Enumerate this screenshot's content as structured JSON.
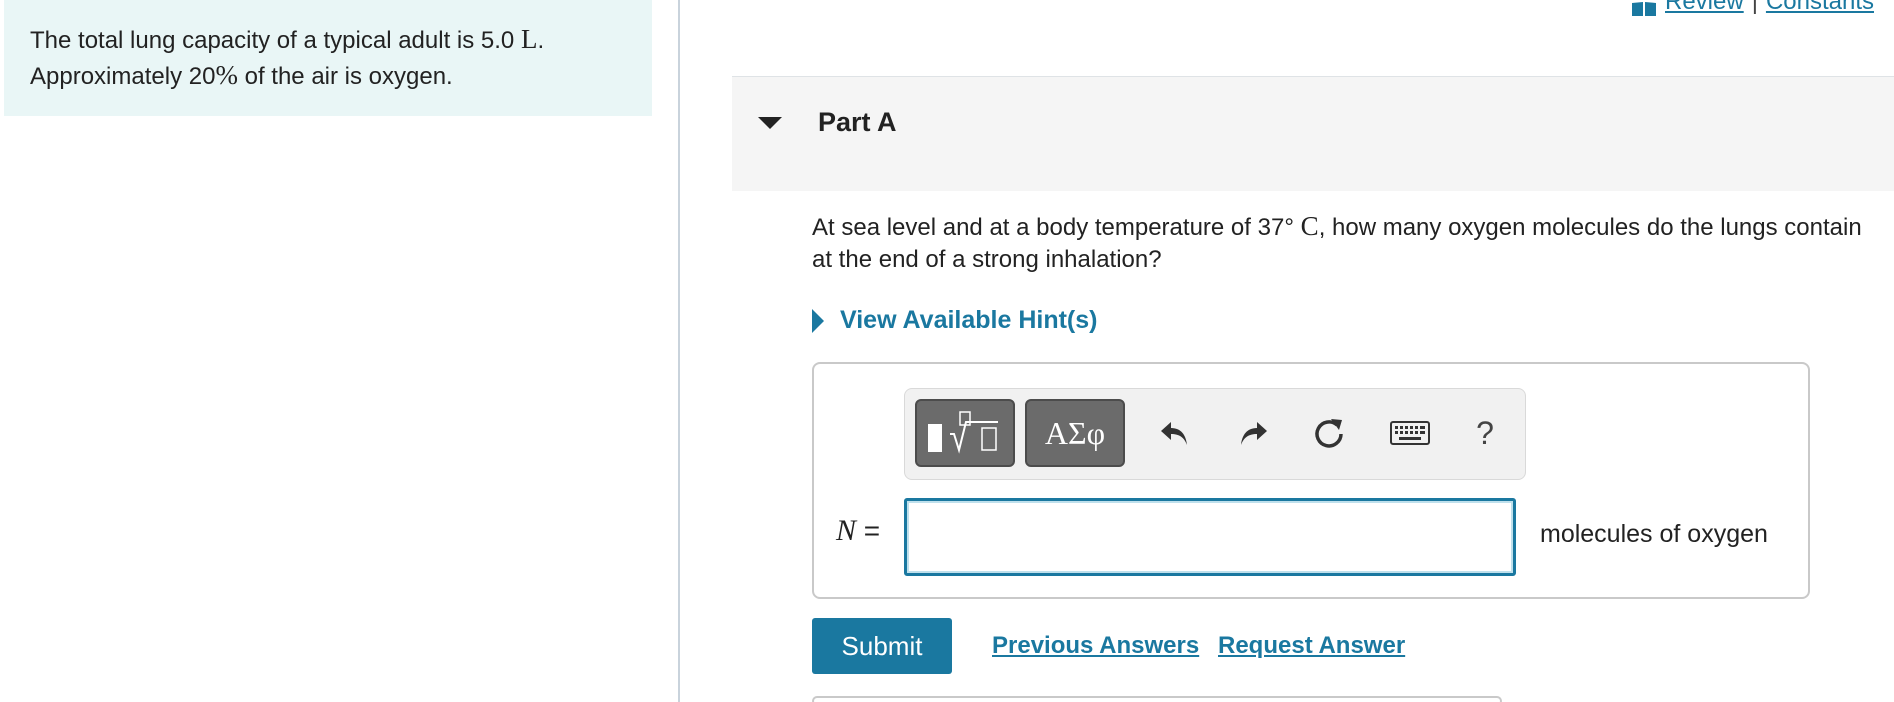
{
  "info": {
    "line1_before": "The total lung capacity of a typical adult is 5.0 ",
    "line1_sym": "L",
    "line1_after": ".",
    "line2_before": "Approximately 20",
    "line2_sym": "%",
    "line2_after": " of the air is oxygen."
  },
  "top_links": {
    "review": "Review",
    "separator": "|",
    "constants": "Constants"
  },
  "part": {
    "title": "Part A"
  },
  "question": {
    "before": "At sea level and at a body temperature of 37",
    "degree": "°",
    "unit": " C",
    "after": ", how many oxygen molecules do the lungs contain at the end of a strong inhalation?"
  },
  "hint": {
    "label": "View Available Hint(s)"
  },
  "toolbar": {
    "greek_label": "ΑΣφ",
    "help_label": "?"
  },
  "answer": {
    "variable": "N",
    "equals": " =",
    "value": "",
    "units": "molecules of oxygen"
  },
  "actions": {
    "submit": "Submit",
    "previous_answers": "Previous Answers",
    "request_answer": "Request Answer"
  },
  "colors": {
    "accent": "#1a78a0",
    "info_bg": "#e9f6f6",
    "toolbar_button": "#6b6b6b"
  }
}
